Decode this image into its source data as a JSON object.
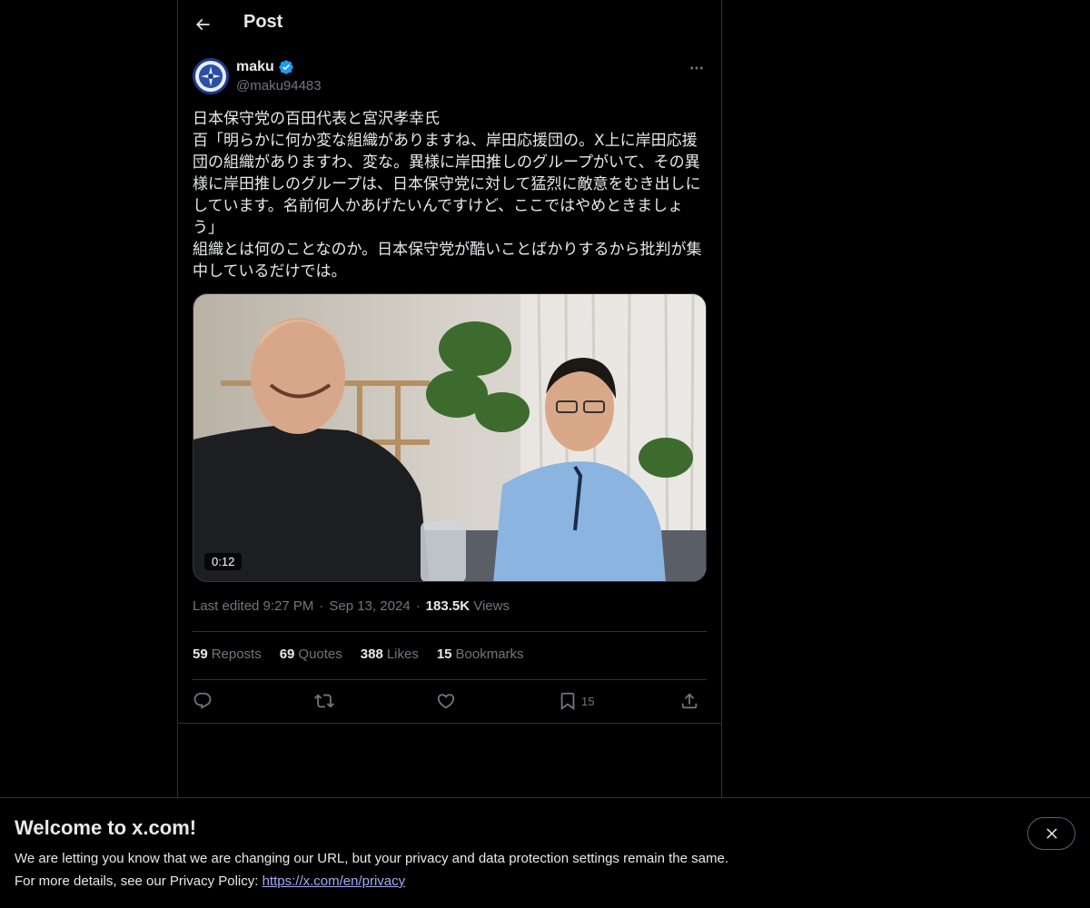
{
  "header": {
    "title": "Post"
  },
  "author": {
    "display_name": "maku",
    "handle": "@maku94483",
    "verified": true
  },
  "tweet": {
    "text": "日本保守党の百田代表と宮沢孝幸氏\n百「明らかに何か変な組織がありますね、岸田応援団の。X上に岸田応援団の組織がありますわ、変な。異様に岸田推しのグループがいて、その異様に岸田推しのグループは、日本保守党に対して猛烈に敵意をむき出しにしています。名前何人かあげたいんですけど、ここではやめときましょう」\n組織とは何のことなのか。日本保守党が酷いことばかりするから批判が集中しているだけでは。",
    "video_duration": "0:12"
  },
  "meta": {
    "edited": "Last edited 9:27 PM",
    "date": "Sep 13, 2024",
    "views_count": "183.5K",
    "views_label": "Views",
    "sep": "·"
  },
  "stats": {
    "reposts": {
      "count": "59",
      "label": "Reposts"
    },
    "quotes": {
      "count": "69",
      "label": "Quotes"
    },
    "likes": {
      "count": "388",
      "label": "Likes"
    },
    "bookmarks": {
      "count": "15",
      "label": "Bookmarks"
    }
  },
  "actions": {
    "bookmark_count": "15"
  },
  "banner": {
    "title": "Welcome to x.com!",
    "line1": "We are letting you know that we are changing our URL, but your privacy and data protection settings remain the same.",
    "line2_prefix": "For more details, see our Privacy Policy: ",
    "link": "https://x.com/en/privacy"
  },
  "colors": {
    "background": "#000000",
    "text": "#e7e9ea",
    "muted": "#71767b",
    "border": "#2f3336",
    "verified": "#1d9bf0",
    "link": "#a5a9f5"
  }
}
